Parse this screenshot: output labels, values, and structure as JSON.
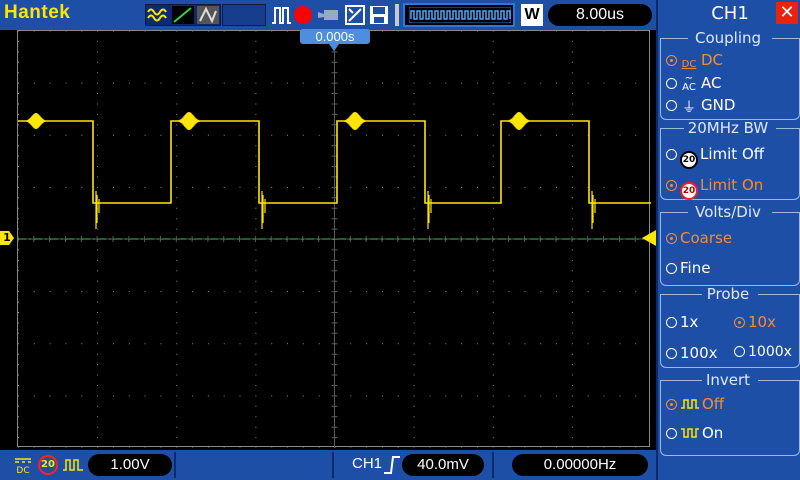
{
  "top_bar": {
    "brand": "Hantek",
    "timebase": "8.00us",
    "waveform_mode_badge": "W",
    "trigger_position": "0.000s",
    "icons": [
      "waveform-mode-icon",
      "pulse-trigger-icon",
      "run-stop-icon",
      "camera-icon",
      "measure-tool-icon",
      "save-icon",
      "memory-waveform-icon"
    ]
  },
  "channel": {
    "marker": "1",
    "color": "#ffe600"
  },
  "bottom_bar": {
    "coupling_icon": "dc-coupling-icon",
    "bw_badge": "20",
    "volts_div": "1.00V",
    "trigger_source": "CH1",
    "trigger_level": "40.0mV",
    "frequency": "0.00000Hz"
  },
  "menu": {
    "title": "CH1",
    "close": "✕",
    "coupling": {
      "title": "Coupling",
      "options": [
        {
          "icon_text": "DC",
          "label": "DC",
          "selected": true
        },
        {
          "icon_text": "AC",
          "label": "AC",
          "selected": false
        },
        {
          "icon_text": "GND",
          "label": "GND",
          "selected": false
        }
      ]
    },
    "bw": {
      "title": "20MHz BW",
      "badge": "20",
      "off": "Limit Off",
      "on": "Limit On",
      "selected": "on"
    },
    "volts_div": {
      "title": "Volts/Div",
      "coarse": "Coarse",
      "fine": "Fine",
      "selected": "coarse"
    },
    "probe": {
      "title": "Probe",
      "options": [
        "1x",
        "10x",
        "100x",
        "1000x"
      ],
      "selected": "10x"
    },
    "invert": {
      "title": "Invert",
      "off": "Off",
      "on": "On",
      "selected": "off"
    }
  },
  "colors": {
    "bar_blue": "#1e4fa6",
    "trace": "#ffe600",
    "selected_option": "#ff8a2a",
    "ground_line": "#2e9a3e"
  }
}
